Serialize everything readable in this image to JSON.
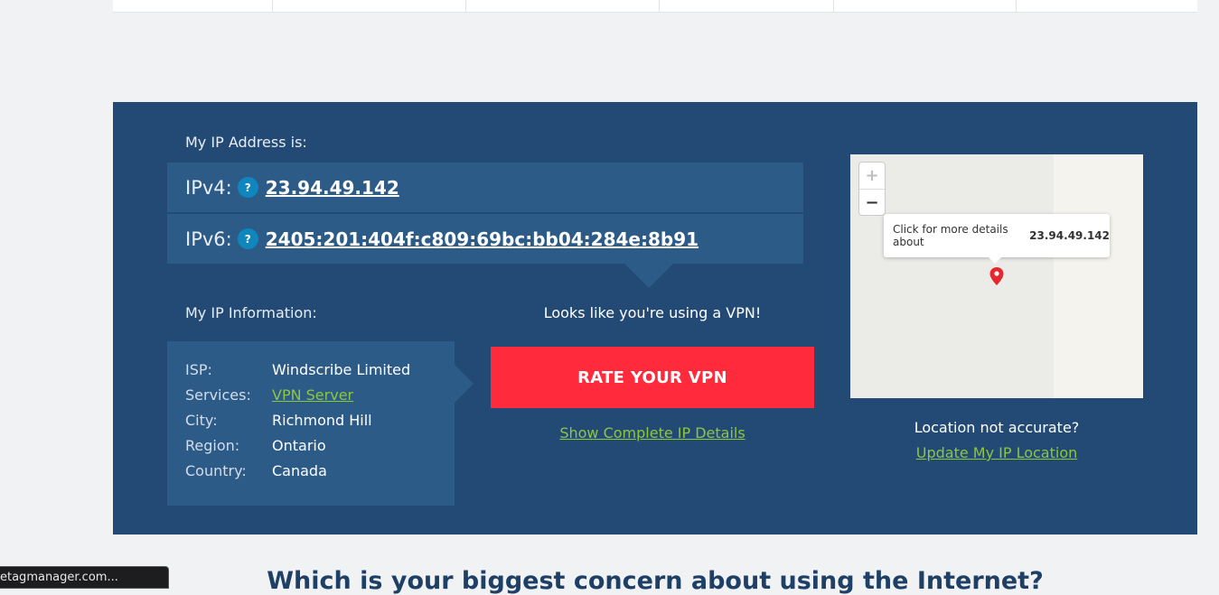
{
  "ip_address": {
    "heading": "My IP Address is:",
    "ipv4_label": "IPv4:",
    "ipv4_value": "23.94.49.142",
    "ipv6_label": "IPv6:",
    "ipv6_value": "2405:201:404f:c809:69bc:bb04:284e:8b91",
    "help_glyph": "?"
  },
  "ip_info": {
    "heading": "My IP Information:",
    "rows": [
      {
        "key": "ISP:",
        "value": "Windscribe Limited"
      },
      {
        "key": "Services:",
        "value": "VPN Server"
      },
      {
        "key": "City:",
        "value": "Richmond Hill"
      },
      {
        "key": "Region:",
        "value": "Ontario"
      },
      {
        "key": "Country:",
        "value": "Canada"
      }
    ]
  },
  "vpn": {
    "message": "Looks like you're using a VPN!",
    "rate_button": "RATE YOUR VPN",
    "details_link": "Show Complete IP Details"
  },
  "map": {
    "zoom_in": "+",
    "zoom_out": "−",
    "popup_text": "Click for more details about",
    "popup_ip": "23.94.49.142",
    "pin_icon": "map-marker"
  },
  "location": {
    "question": "Location not accurate?",
    "update_link": "Update My IP Location"
  },
  "concern": {
    "heading": "Which is your biggest concern about using the Internet?"
  },
  "status_bar": {
    "text": "etagmanager.com..."
  },
  "colors": {
    "panel_bg": "#234a75",
    "row_bg": "#2d5b88",
    "accent_red": "#ff2a3b",
    "link_green": "#8dc63f",
    "help_blue": "#0f86bd"
  }
}
